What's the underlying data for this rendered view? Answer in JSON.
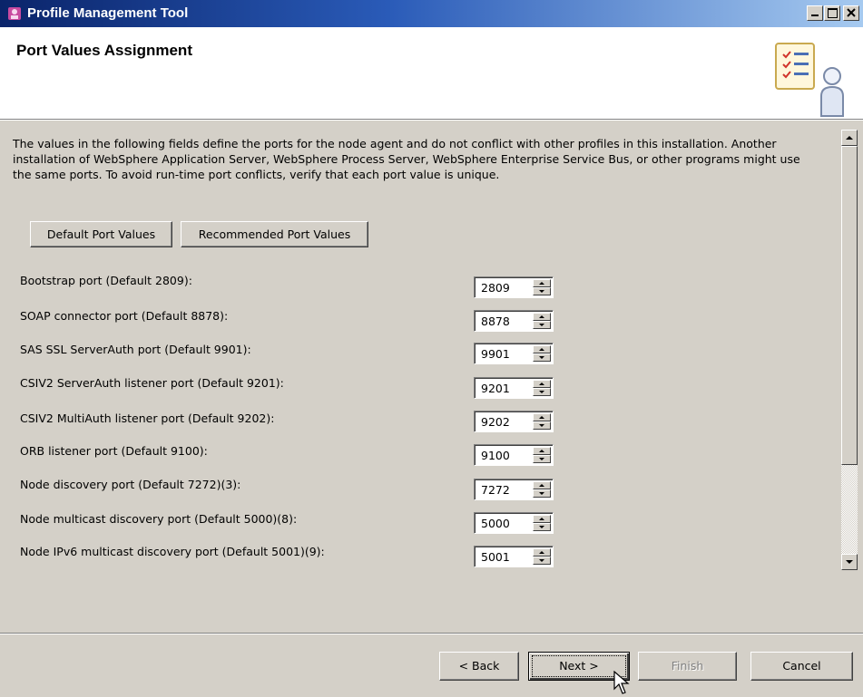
{
  "window": {
    "title": "Profile Management Tool"
  },
  "header": {
    "title": "Port Values Assignment"
  },
  "description": "The values in the following fields define the ports for the node agent and do not conflict with other profiles in this installation. Another installation of WebSphere Application Server, WebSphere Process Server, WebSphere Enterprise Service Bus, or other programs might use the same ports. To avoid run-time port conflicts, verify that each port value is unique.",
  "buttons": {
    "default_ports": "Default Port Values",
    "recommended_ports": "Recommended Port Values",
    "back": "< Back",
    "next": "Next >",
    "finish": "Finish",
    "cancel": "Cancel"
  },
  "ports": [
    {
      "label": "Bootstrap port (Default 2809):",
      "value": "2809"
    },
    {
      "label": "SOAP connector port (Default 8878):",
      "value": "8878"
    },
    {
      "label": "SAS SSL ServerAuth port (Default 9901):",
      "value": "9901"
    },
    {
      "label": "CSIV2 ServerAuth listener port (Default 9201):",
      "value": "9201"
    },
    {
      "label": "CSIV2 MultiAuth listener port (Default 9202):",
      "value": "9202"
    },
    {
      "label": "ORB listener port (Default 9100):",
      "value": "9100"
    },
    {
      "label": "Node discovery port (Default 7272)(3):",
      "value": "7272"
    },
    {
      "label": "Node multicast discovery port (Default 5000)(8):",
      "value": "5000"
    },
    {
      "label": "Node IPv6 multicast discovery port (Default 5001)(9):",
      "value": "5001"
    }
  ],
  "icons": {
    "app": "profile-tool-icon",
    "header": "checklist-person-icon"
  },
  "colors": {
    "titlebar_start": "#0a246a",
    "titlebar_end": "#a6caf0",
    "face": "#d4d0c8"
  }
}
